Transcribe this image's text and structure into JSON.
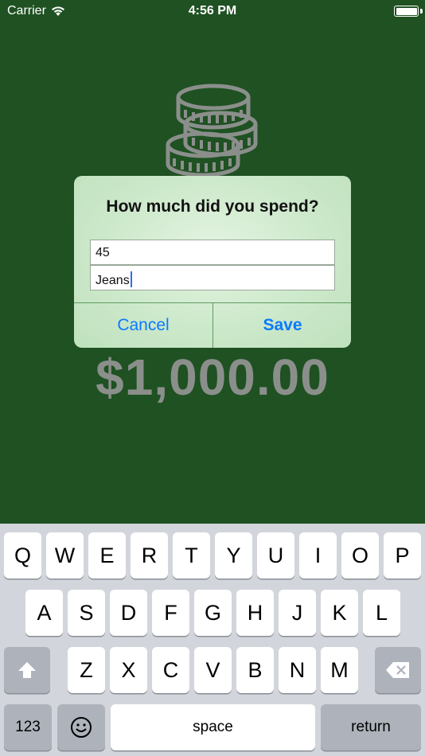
{
  "status_bar": {
    "carrier": "Carrier",
    "time": "4:56 PM",
    "wifi_icon": "wifi-icon",
    "battery_icon": "battery-icon"
  },
  "main": {
    "coins_icon": "coins-stack-icon",
    "balance": "$1,000.00"
  },
  "dialog": {
    "title": "How much did you spend?",
    "amount_value": "45",
    "description_value": "Jeans",
    "cancel_label": "Cancel",
    "save_label": "Save"
  },
  "keyboard": {
    "row1": [
      "Q",
      "W",
      "E",
      "R",
      "T",
      "Y",
      "U",
      "I",
      "O",
      "P"
    ],
    "row2": [
      "A",
      "S",
      "D",
      "F",
      "G",
      "H",
      "J",
      "K",
      "L"
    ],
    "row3": [
      "Z",
      "X",
      "C",
      "V",
      "B",
      "N",
      "M"
    ],
    "shift_icon": "shift-icon",
    "delete_icon": "delete-icon",
    "numbers_label": "123",
    "emoji_icon": "emoji-icon",
    "space_label": "space",
    "return_label": "return"
  },
  "colors": {
    "background": "#1f5122",
    "balance_text": "#8b8f8b",
    "dialog_button": "#0a7aff",
    "keyboard_background": "#d2d5db"
  }
}
